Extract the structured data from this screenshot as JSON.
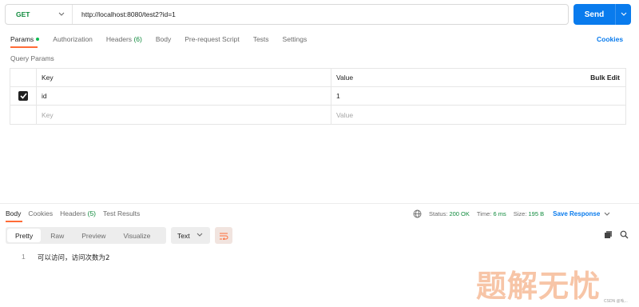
{
  "request": {
    "method": "GET",
    "url": "http://localhost:8080/test2?id=1",
    "send_label": "Send"
  },
  "request_tabs": {
    "params": "Params",
    "authorization": "Authorization",
    "headers": "Headers",
    "headers_count": "(6)",
    "body": "Body",
    "prerequest": "Pre-request Script",
    "tests": "Tests",
    "settings": "Settings"
  },
  "cookies_label": "Cookies",
  "query_params": {
    "title": "Query Params",
    "col_key": "Key",
    "col_value": "Value",
    "bulk_edit": "Bulk Edit",
    "rows": [
      {
        "checked": true,
        "key": "id",
        "value": "1"
      }
    ],
    "placeholder_key": "Key",
    "placeholder_value": "Value"
  },
  "response_tabs": {
    "body": "Body",
    "cookies": "Cookies",
    "headers": "Headers",
    "headers_count": "(5)",
    "test_results": "Test Results"
  },
  "response_meta": {
    "status_label": "Status:",
    "status_value": "200 OK",
    "time_label": "Time:",
    "time_value": "6 ms",
    "size_label": "Size:",
    "size_value": "195 B",
    "save_response": "Save Response"
  },
  "format": {
    "pretty": "Pretty",
    "raw": "Raw",
    "preview": "Preview",
    "visualize": "Visualize",
    "language": "Text"
  },
  "response_body": {
    "line_number": "1",
    "content": "可以访问，访问次数为2"
  },
  "watermark": {
    "text": "题解无忧",
    "source": "CSDN @吆..."
  },
  "colors": {
    "accent": "#ff6c37",
    "primary": "#097bed",
    "success": "#0f8a3c"
  }
}
